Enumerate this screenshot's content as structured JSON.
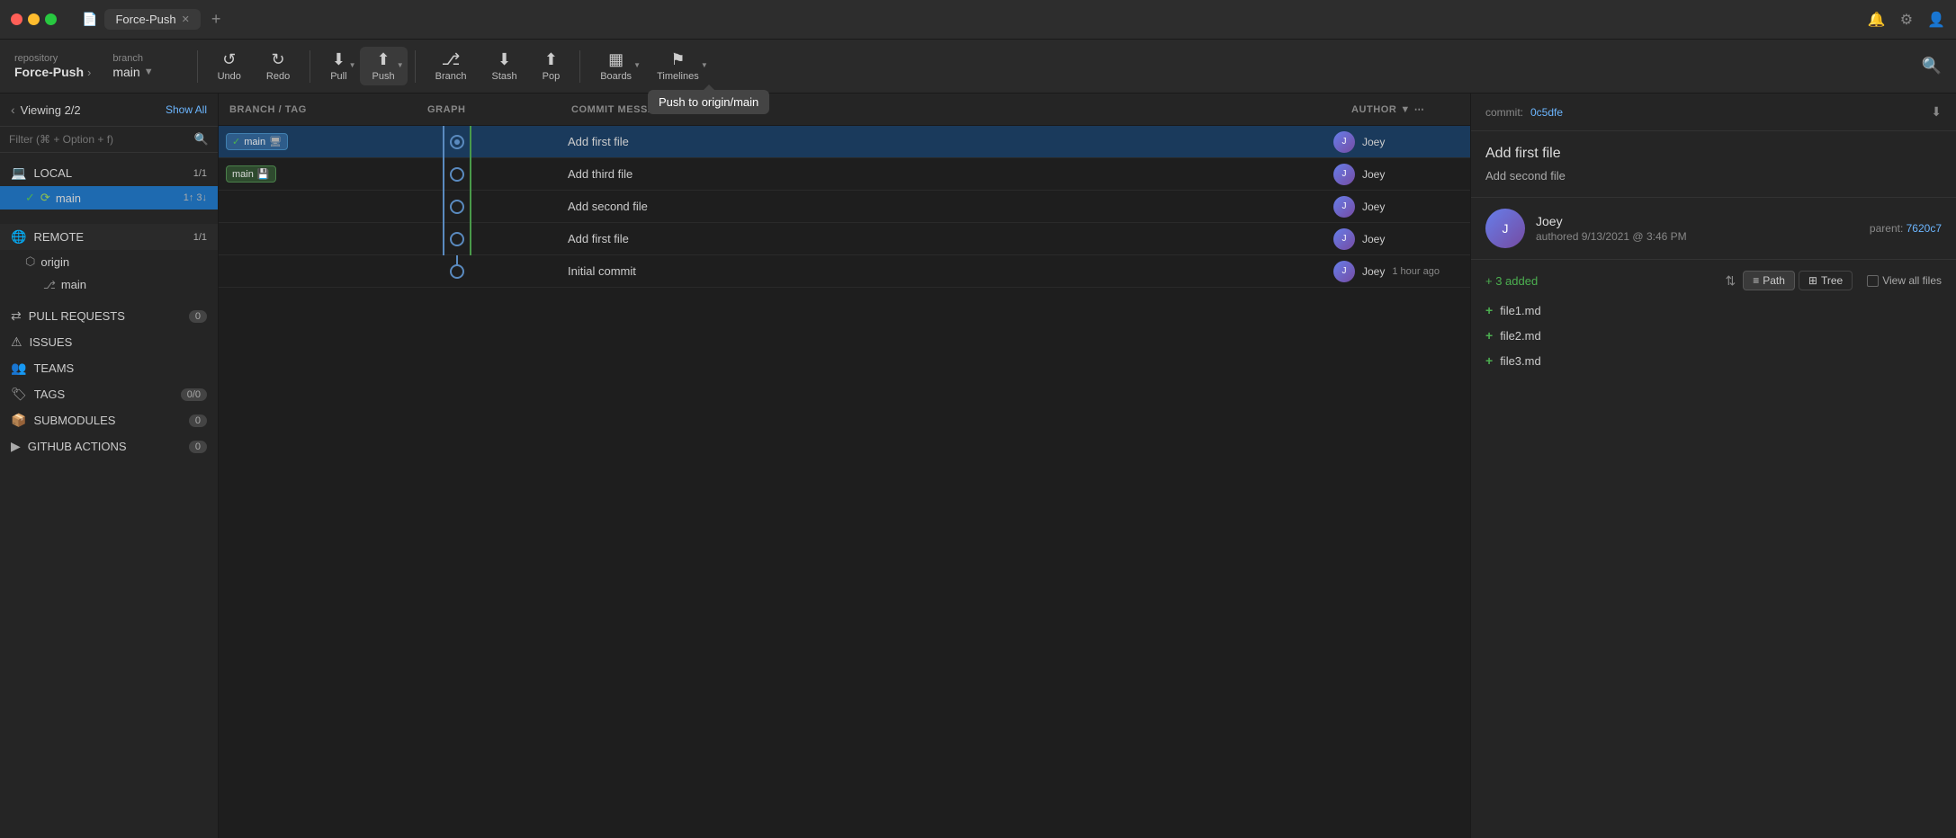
{
  "titlebar": {
    "tab_name": "Force-Push",
    "add_tab": "+",
    "icons": {
      "bell": "🔔",
      "settings": "⚙",
      "avatar": "👤"
    }
  },
  "toolbar": {
    "repo_label": "repository",
    "repo_name": "Force-Push",
    "branch_label": "branch",
    "branch_name": "main",
    "undo_label": "Undo",
    "redo_label": "Redo",
    "pull_label": "Pull",
    "push_label": "Push",
    "branch_label2": "Branch",
    "stash_label": "Stash",
    "pop_label": "Pop",
    "boards_label": "Boards",
    "timelines_label": "Timelines",
    "tooltip": "Push to origin/main"
  },
  "sidebar": {
    "viewing": "Viewing 2/2",
    "show_all": "Show All",
    "filter_placeholder": "Filter (⌘ + Option + f)",
    "local_label": "LOCAL",
    "local_count": "1/1",
    "main_branch": "main",
    "main_badge": "1↑ 3↓",
    "remote_label": "REMOTE",
    "remote_count": "1/1",
    "origin_label": "origin",
    "remote_main": "main",
    "pull_requests_label": "PULL REQUESTS",
    "pull_requests_count": "0",
    "issues_label": "ISSUES",
    "teams_label": "TEAMS",
    "tags_label": "TAGS",
    "tags_count": "0/0",
    "submodules_label": "SUBMODULES",
    "submodules_count": "0",
    "github_actions_label": "GITHUB ACTIONS",
    "github_actions_count": "0"
  },
  "commit_list": {
    "col_branch_tag": "BRANCH / TAG",
    "col_graph": "GRAPH",
    "col_message": "COMMIT MESSAGE",
    "col_author": "AUTHOR",
    "commits": [
      {
        "id": 1,
        "branch_tags": [
          {
            "label": "main",
            "type": "local_checked"
          },
          {
            "label": "main",
            "type": "remote"
          }
        ],
        "message": "Add first file",
        "author": "Joey",
        "timestamp": "",
        "selected": true
      },
      {
        "id": 2,
        "branch_tags": [
          {
            "label": "main",
            "type": "local_disk"
          }
        ],
        "message": "Add third file",
        "author": "Joey",
        "timestamp": "",
        "selected": false
      },
      {
        "id": 3,
        "branch_tags": [],
        "message": "Add second file",
        "author": "Joey",
        "timestamp": "",
        "selected": false
      },
      {
        "id": 4,
        "branch_tags": [],
        "message": "Add first file",
        "author": "Joey",
        "timestamp": "",
        "selected": false
      },
      {
        "id": 5,
        "branch_tags": [],
        "message": "Initial commit",
        "author": "Joey",
        "timestamp": "1 hour ago",
        "selected": false
      }
    ]
  },
  "right_panel": {
    "commit_label": "commit:",
    "commit_hash": "0c5dfe",
    "commit_title": "Add first file",
    "commit_subtitle": "Add second file",
    "author_name": "Joey",
    "authored_text": "authored 9/13/2021 @ 3:46 PM",
    "parent_label": "parent:",
    "parent_hash": "7620c7",
    "added_count": "+ 3 added",
    "sort_icon": "⇅",
    "path_label": "Path",
    "tree_label": "Tree",
    "view_all_label": "View all files",
    "files": [
      {
        "name": "file1.md",
        "status": "+"
      },
      {
        "name": "file2.md",
        "status": "+"
      },
      {
        "name": "file3.md",
        "status": "+"
      }
    ]
  }
}
